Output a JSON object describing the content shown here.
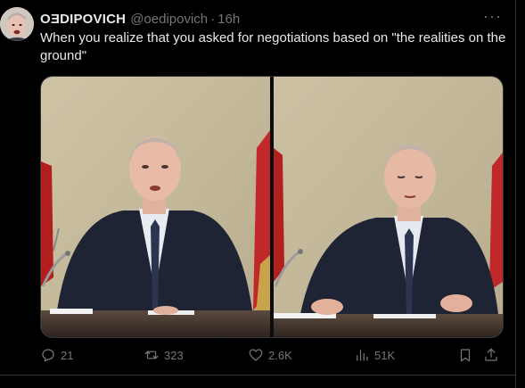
{
  "tweet": {
    "author_name": "OƎDIPOVICH",
    "handle": "@oedipovich",
    "separator": "·",
    "time": "16h",
    "more_label": "···",
    "text": "When you realize that you asked for negotiations based on \"the realities on the ground\""
  },
  "actions": {
    "replies": "21",
    "reposts": "323",
    "likes": "2.6K",
    "views": "51K"
  },
  "icons": [
    "reply-icon",
    "repost-icon",
    "like-icon",
    "views-icon",
    "bookmark-icon",
    "share-icon"
  ],
  "colors": {
    "background": "#000000",
    "text": "#e7e9ea",
    "muted": "#71767b",
    "border": "#2f3336"
  }
}
